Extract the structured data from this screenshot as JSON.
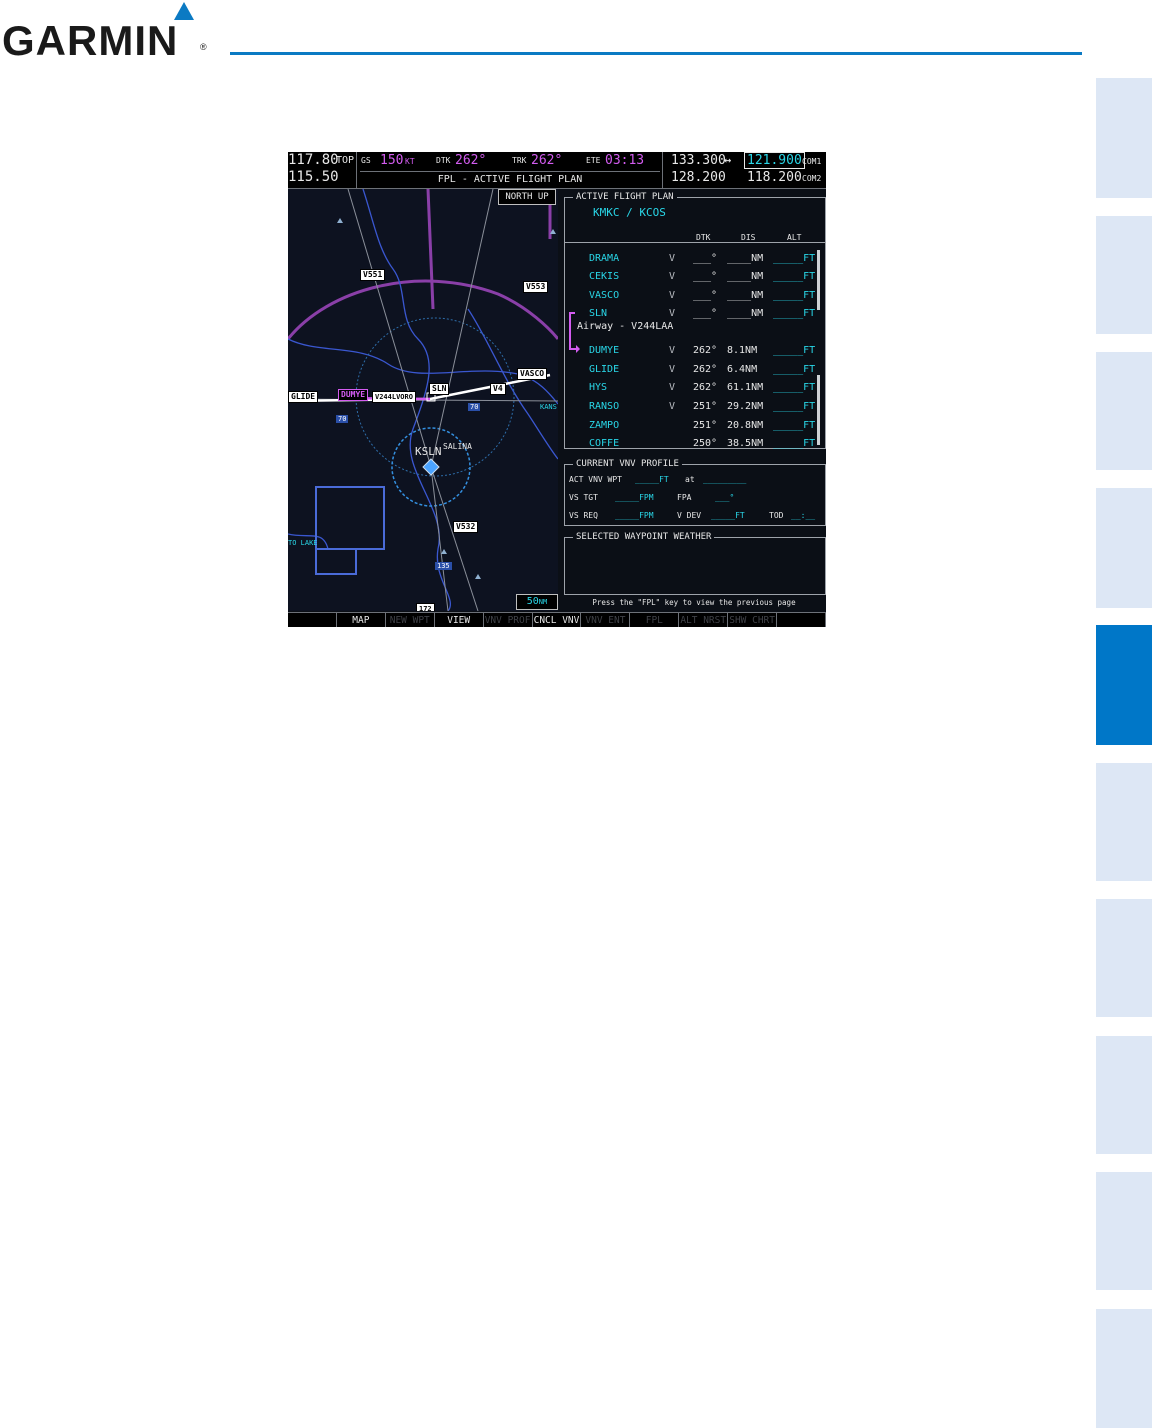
{
  "page": {
    "brand": "GARMIN",
    "registered": "®"
  },
  "mfd": {
    "top": {
      "nav1": "117.80",
      "nav2": "115.50",
      "top_label": "TOP",
      "gs_label": "GS",
      "gs_value": "150",
      "gs_unit": "KT",
      "dtk_label": "DTK",
      "dtk_value": "262°",
      "trk_label": "TRK",
      "trk_value": "262°",
      "ete_label": "ETE",
      "ete_value": "03:13",
      "com1_active": "133.300",
      "com_swap": "↔",
      "com1_standby": "121.900",
      "com1_label": "COM1",
      "com2_active": "128.200",
      "com2_standby": "118.200",
      "com2_label": "COM2",
      "page_title": "FPL - ACTIVE FLIGHT PLAN"
    },
    "map": {
      "orientation": "NORTH UP",
      "range": "50",
      "range_unit": "NM",
      "labels": {
        "v551": "V551",
        "v553": "V553",
        "vasco": "VASCO",
        "sln": "SLN",
        "v4": "V4",
        "glide": "GLIDE",
        "dumye": "DUMYE",
        "v244": "V244LVORO",
        "ksln": "KSLN",
        "salina": "SALINA",
        "v532": "V532",
        "i135": "135",
        "i70a": "70",
        "i70b": "70",
        "kans": "KANS",
        "lake": "TO LAKE",
        "i172": "172"
      }
    },
    "fpl": {
      "title": "ACTIVE FLIGHT PLAN",
      "route": "KMKC / KCOS",
      "col_dtk": "DTK",
      "col_dis": "DIS",
      "col_alt": "ALT",
      "airway": "Airway - V244LAA",
      "rows": [
        {
          "wpt": "DRAMA",
          "vnv": "V",
          "dtk": "___°",
          "dis": "____NM",
          "alt": "_____FT"
        },
        {
          "wpt": "CEKIS",
          "vnv": "V",
          "dtk": "___°",
          "dis": "____NM",
          "alt": "_____FT"
        },
        {
          "wpt": "VASCO",
          "vnv": "V",
          "dtk": "___°",
          "dis": "____NM",
          "alt": "_____FT"
        },
        {
          "wpt": "SLN",
          "vnv": "V",
          "dtk": "___°",
          "dis": "____NM",
          "alt": "_____FT"
        },
        {
          "wpt": "DUMYE",
          "vnv": "V",
          "dtk": "262°",
          "dis": "8.1NM",
          "alt": "_____FT"
        },
        {
          "wpt": "GLIDE",
          "vnv": "V",
          "dtk": "262°",
          "dis": "6.4NM",
          "alt": "_____FT"
        },
        {
          "wpt": "HYS",
          "vnv": "V",
          "dtk": "262°",
          "dis": "61.1NM",
          "alt": "_____FT"
        },
        {
          "wpt": "RANSO",
          "vnv": "V",
          "dtk": "251°",
          "dis": "29.2NM",
          "alt": "_____FT"
        },
        {
          "wpt": "ZAMPO",
          "vnv": "",
          "dtk": "251°",
          "dis": "20.8NM",
          "alt": "_____FT"
        },
        {
          "wpt": "COFFE",
          "vnv": "",
          "dtk": "250°",
          "dis": "38.5NM",
          "alt": "_____FT"
        }
      ]
    },
    "vnv": {
      "title": "CURRENT VNV PROFILE",
      "act_wpt_label": "ACT VNV WPT",
      "act_wpt_alt": "_____FT",
      "at_label": "at",
      "act_wpt_name": "_________",
      "vs_tgt_label": "VS TGT",
      "vs_tgt_value": "_____FPM",
      "fpa_label": "FPA",
      "fpa_value": "___°",
      "vs_req_label": "VS REQ",
      "vs_req_value": "_____FPM",
      "vdev_label": "V DEV",
      "vdev_value": "_____FT",
      "tod_label": "TOD",
      "tod_value": "__:__"
    },
    "weather": {
      "title": "SELECTED WAYPOINT WEATHER",
      "hint": "Press the \"FPL\" key to view the previous page"
    },
    "softkeys": [
      {
        "label": "",
        "on": true
      },
      {
        "label": "MAP",
        "on": true
      },
      {
        "label": "NEW WPT",
        "on": false
      },
      {
        "label": "VIEW",
        "on": true
      },
      {
        "label": "VNV PROF",
        "on": false
      },
      {
        "label": "CNCL VNV",
        "on": true
      },
      {
        "label": "VNV ENT",
        "on": false
      },
      {
        "label": "FPL",
        "on": false
      },
      {
        "label": "ALT NRST",
        "on": false
      },
      {
        "label": "SHW CHRT",
        "on": false
      },
      {
        "label": "",
        "on": false
      }
    ]
  }
}
